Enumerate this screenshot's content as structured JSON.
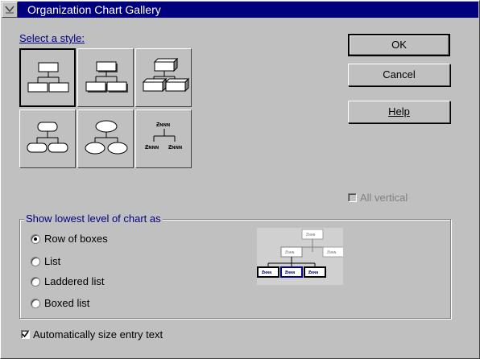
{
  "window": {
    "title": "Organization Chart Gallery"
  },
  "style_picker": {
    "label": "Select a style:",
    "styles": [
      {
        "name": "boxes-flat",
        "selected": true
      },
      {
        "name": "boxes-shadow",
        "selected": false
      },
      {
        "name": "boxes-3d",
        "selected": false
      },
      {
        "name": "rounded-boxes",
        "selected": false
      },
      {
        "name": "ovals",
        "selected": false
      },
      {
        "name": "names-only",
        "selected": false
      }
    ],
    "names_only_sample": "Ƶɴɴɴ"
  },
  "buttons": {
    "ok": "OK",
    "cancel": "Cancel",
    "help": "Help"
  },
  "all_vertical": {
    "label": "All vertical",
    "checked": false,
    "enabled": false
  },
  "lowest_level": {
    "label": "Show lowest level of chart as",
    "options": [
      {
        "label": "Row of boxes",
        "selected": true
      },
      {
        "label": "List",
        "selected": false
      },
      {
        "label": "Laddered list",
        "selected": false
      },
      {
        "label": "Boxed list",
        "selected": false
      }
    ]
  },
  "preview": {
    "box_text": "Ƶɴɴɴ"
  },
  "auto_size": {
    "label": "Automatically size entry text",
    "checked": true
  }
}
